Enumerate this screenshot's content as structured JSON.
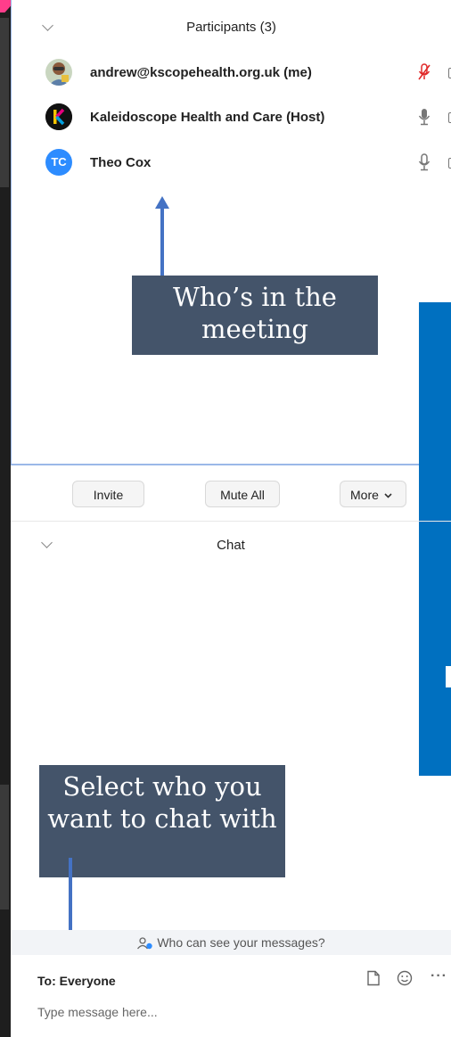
{
  "participants": {
    "title": "Participants (3)",
    "list": [
      {
        "name": "andrew@kscopehealth.org.uk (me)",
        "mic": "muted"
      },
      {
        "name": "Kaleidoscope Health and Care (Host)",
        "mic": "on"
      },
      {
        "name": "Theo Cox",
        "mic": "on",
        "initials": "TC"
      }
    ]
  },
  "callouts": {
    "participants_note": "Who’s in the meeting",
    "chat_note": "Select who you want to chat with"
  },
  "buttons": {
    "invite": "Invite",
    "mute_all": "Mute All",
    "more": "More"
  },
  "chat": {
    "title": "Chat",
    "visibility_link": "Who can see your messages?",
    "to_label": "To: Everyone",
    "placeholder": "Type message here..."
  },
  "colors": {
    "callout_bg": "#44546a",
    "arrow": "#4472c4",
    "blue_box": "#0070c0",
    "tc_avatar": "#2d8cff",
    "muted_mic": "#e02828"
  },
  "icons": [
    "chevron-down-icon",
    "mic-muted-icon",
    "mic-icon",
    "video-icon",
    "file-icon",
    "emoji-icon",
    "more-icon",
    "people-icon"
  ]
}
